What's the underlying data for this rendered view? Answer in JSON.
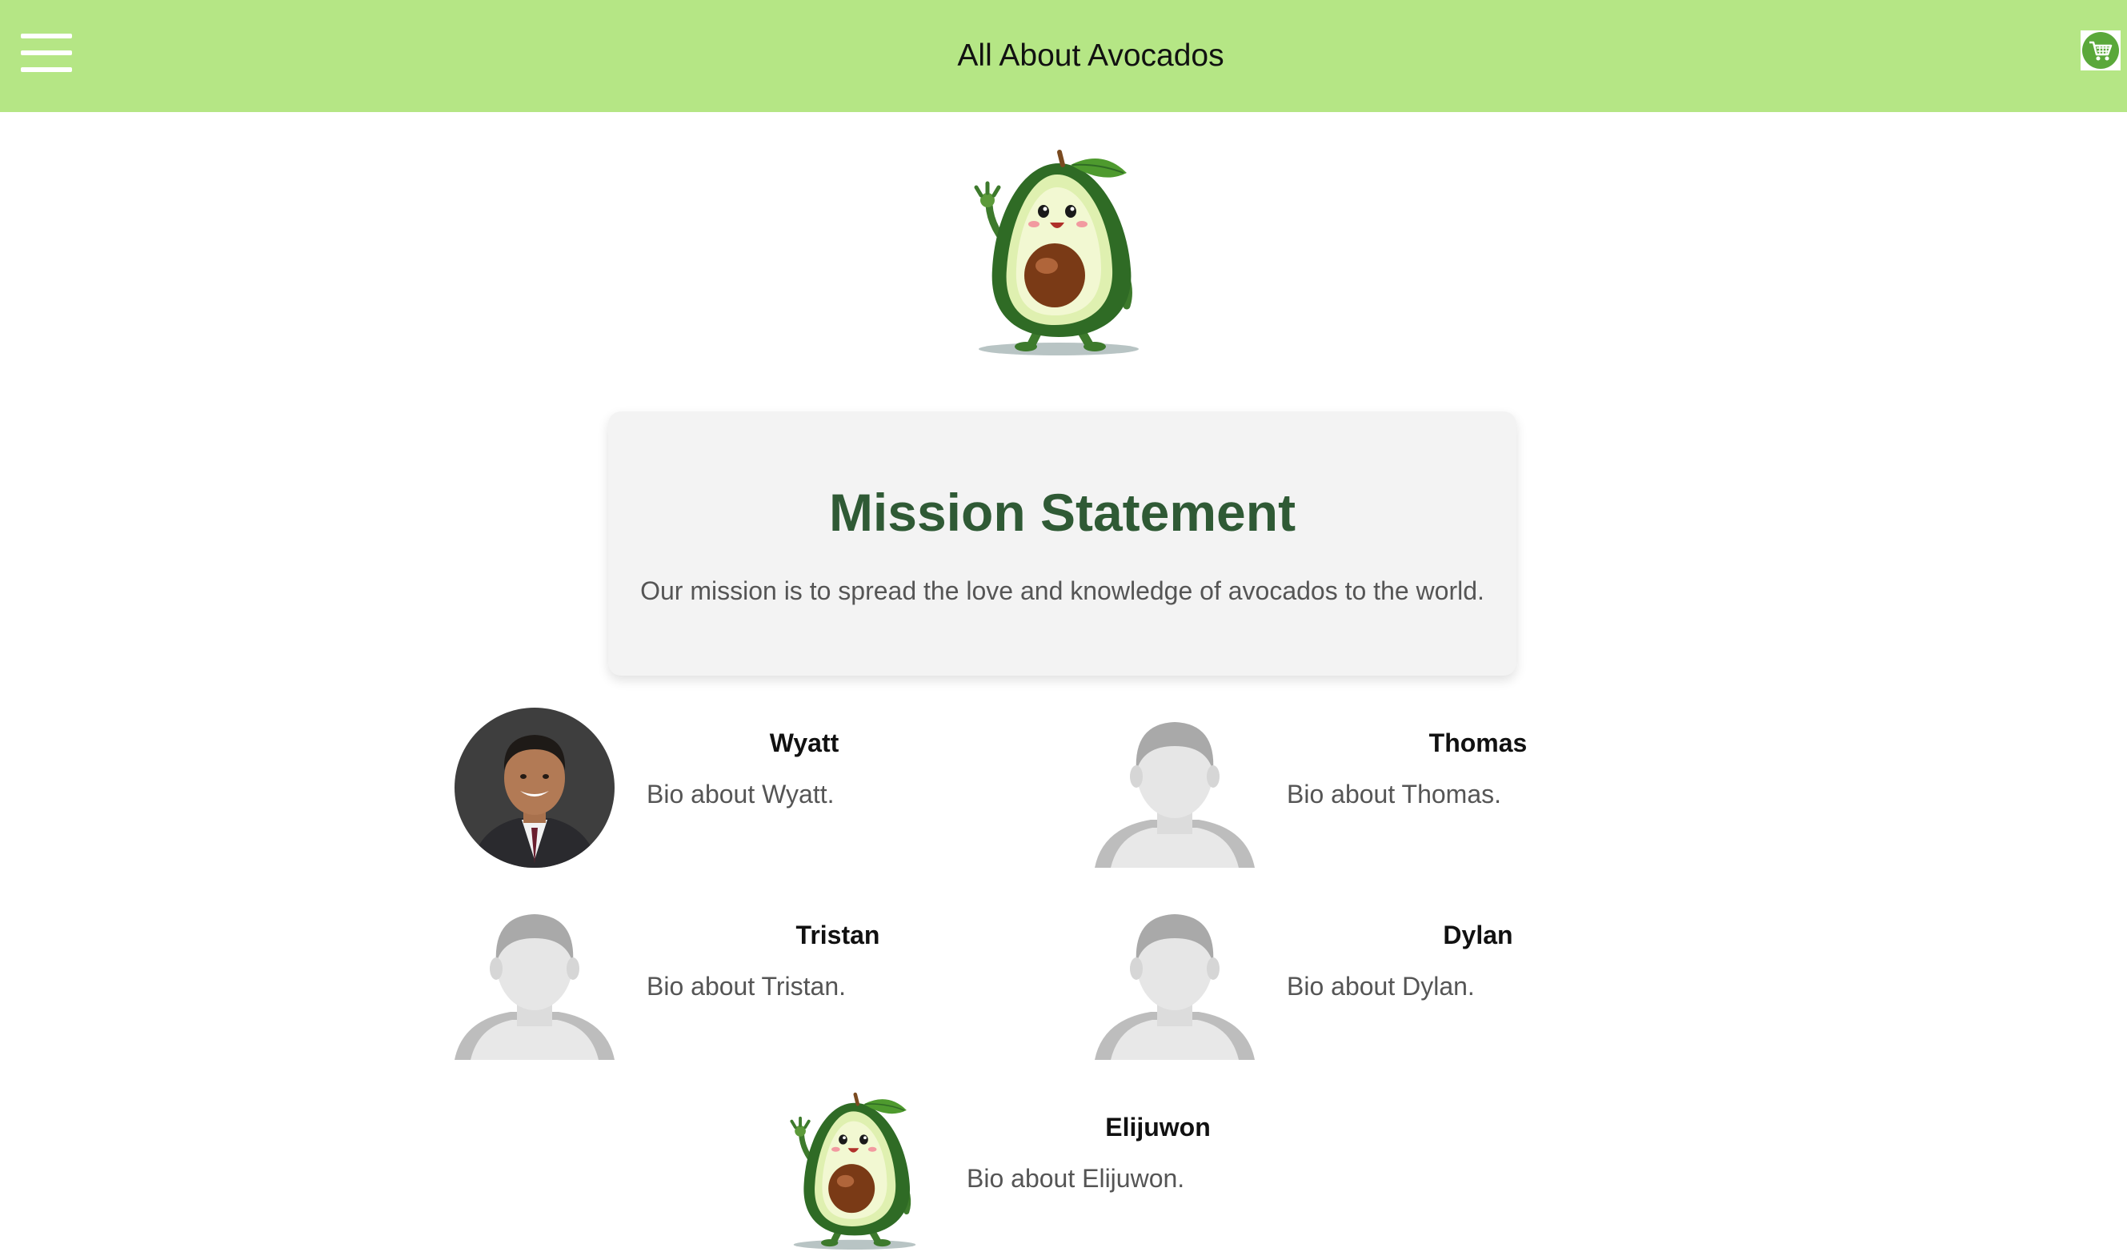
{
  "header": {
    "title": "All About Avocados",
    "menu_icon": "hamburger-menu-icon",
    "cart_icon": "shopping-cart-icon",
    "background_color": "#b5e685"
  },
  "hero": {
    "image": "avocado-mascot"
  },
  "mission": {
    "title": "Mission Statement",
    "text": "Our mission is to spread the love and knowledge of avocados to the world.",
    "title_color": "#2f5a35"
  },
  "team": [
    {
      "name": "Wyatt",
      "bio": "Bio about Wyatt.",
      "photo": "portrait-photo"
    },
    {
      "name": "Thomas",
      "bio": "Bio about Thomas.",
      "photo": "default-avatar"
    },
    {
      "name": "Tristan",
      "bio": "Bio about Tristan.",
      "photo": "default-avatar"
    },
    {
      "name": "Dylan",
      "bio": "Bio about Dylan.",
      "photo": "default-avatar"
    },
    {
      "name": "Elijuwon",
      "bio": "Bio about Elijuwon.",
      "photo": "avocado-mascot"
    }
  ]
}
